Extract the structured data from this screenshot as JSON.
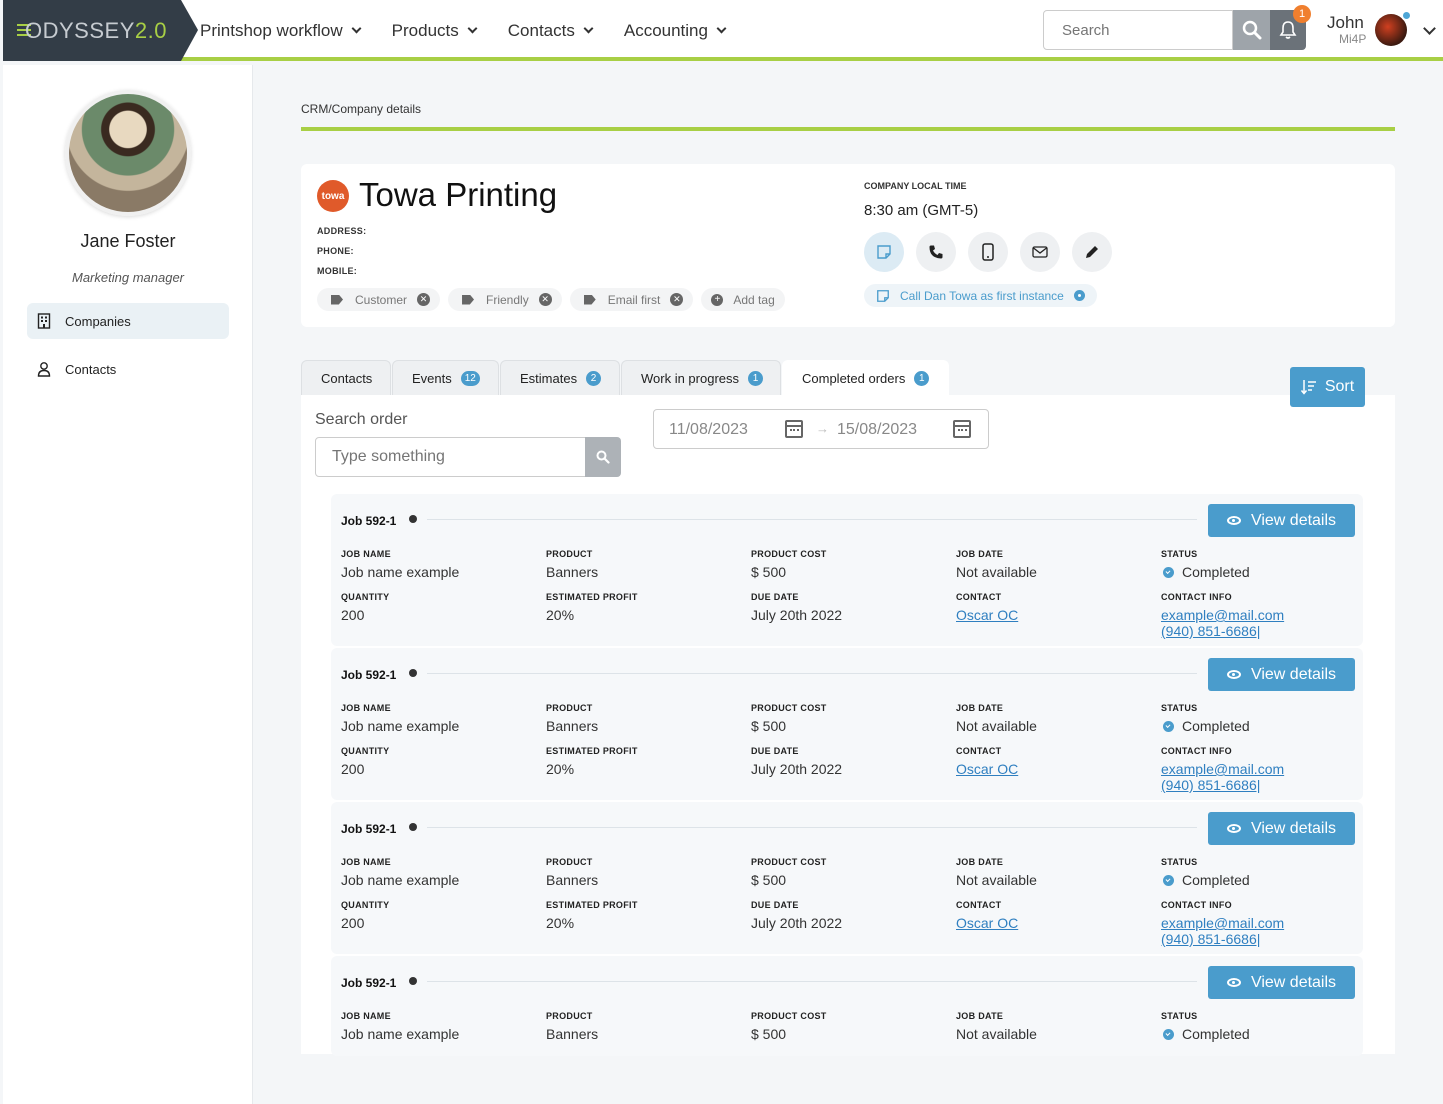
{
  "app": {
    "logo_main": "DYSSEY",
    "logo_prefix": "O",
    "logo_version": "2.0",
    "accent": "#a8cf45",
    "primary": "#4a9ccc"
  },
  "nav": {
    "items": [
      {
        "label": "Printshop workflow"
      },
      {
        "label": "Products"
      },
      {
        "label": "Contacts"
      },
      {
        "label": "Accounting"
      }
    ],
    "search_placeholder": "Search",
    "notifications_count": "1",
    "user_name": "John",
    "user_org": "Mi4P"
  },
  "sidebar": {
    "profile_name": "Jane Foster",
    "profile_role": "Marketing manager",
    "items": [
      {
        "label": "Companies",
        "icon": "building-icon",
        "active": true
      },
      {
        "label": "Contacts",
        "icon": "person-icon",
        "active": false
      }
    ]
  },
  "breadcrumb": "CRM/Company details",
  "company": {
    "logo_text": "towa",
    "name": "Towa Printing",
    "address_label": "ADDRESS:",
    "phone_label": "PHONE:",
    "mobile_label": "MOBILE:",
    "tags": [
      "Customer",
      "Friendly",
      "Email first"
    ],
    "add_tag": "Add tag",
    "local_time_label": "COMPANY LOCAL TIME",
    "local_time": "8:30 am (GMT-5)",
    "note": "Call Dan Towa as first instance"
  },
  "tabs": [
    {
      "label": "Contacts",
      "count": ""
    },
    {
      "label": "Events",
      "count": "12"
    },
    {
      "label": "Estimates",
      "count": "2"
    },
    {
      "label": "Work in progress",
      "count": "1"
    },
    {
      "label": "Completed orders",
      "count": "1",
      "active": true
    }
  ],
  "sort_label": "Sort",
  "search_order": {
    "label": "Search order",
    "placeholder": "Type something"
  },
  "date_range": {
    "start": "11/08/2023",
    "end": "15/08/2023"
  },
  "field_labels": {
    "job_name": "JOB NAME",
    "product": "PRODUCT",
    "product_cost": "PRODUCT COST",
    "job_date": "JOB DATE",
    "status": "STATUS",
    "quantity": "QUANTITY",
    "estimated_profit": "ESTIMATED PROFIT",
    "due_date": "DUE DATE",
    "contact": "CONTACT",
    "contact_info": "CONTACT INFO"
  },
  "view_details_label": "View details",
  "jobs": [
    {
      "title": "Job 592-1",
      "job_name": "Job name example",
      "product": "Banners",
      "product_cost": "$ 500",
      "job_date": "Not available",
      "status": "Completed",
      "quantity": "200",
      "estimated_profit": "20%",
      "due_date": "July 20th 2022",
      "contact": "Oscar OC",
      "email": "example@mail.com",
      "phone": "(940) 851-6686|"
    },
    {
      "title": "Job 592-1",
      "job_name": "Job name example",
      "product": "Banners",
      "product_cost": "$ 500",
      "job_date": "Not available",
      "status": "Completed",
      "quantity": "200",
      "estimated_profit": "20%",
      "due_date": "July 20th 2022",
      "contact": "Oscar OC",
      "email": "example@mail.com",
      "phone": "(940) 851-6686|"
    },
    {
      "title": "Job 592-1",
      "job_name": "Job name example",
      "product": "Banners",
      "product_cost": "$ 500",
      "job_date": "Not available",
      "status": "Completed",
      "quantity": "200",
      "estimated_profit": "20%",
      "due_date": "July 20th 2022",
      "contact": "Oscar OC",
      "email": "example@mail.com",
      "phone": "(940) 851-6686|"
    },
    {
      "title": "Job 592-1",
      "job_name": "Job name example",
      "product": "Banners",
      "product_cost": "$ 500",
      "job_date": "Not available",
      "status": "Completed"
    }
  ]
}
